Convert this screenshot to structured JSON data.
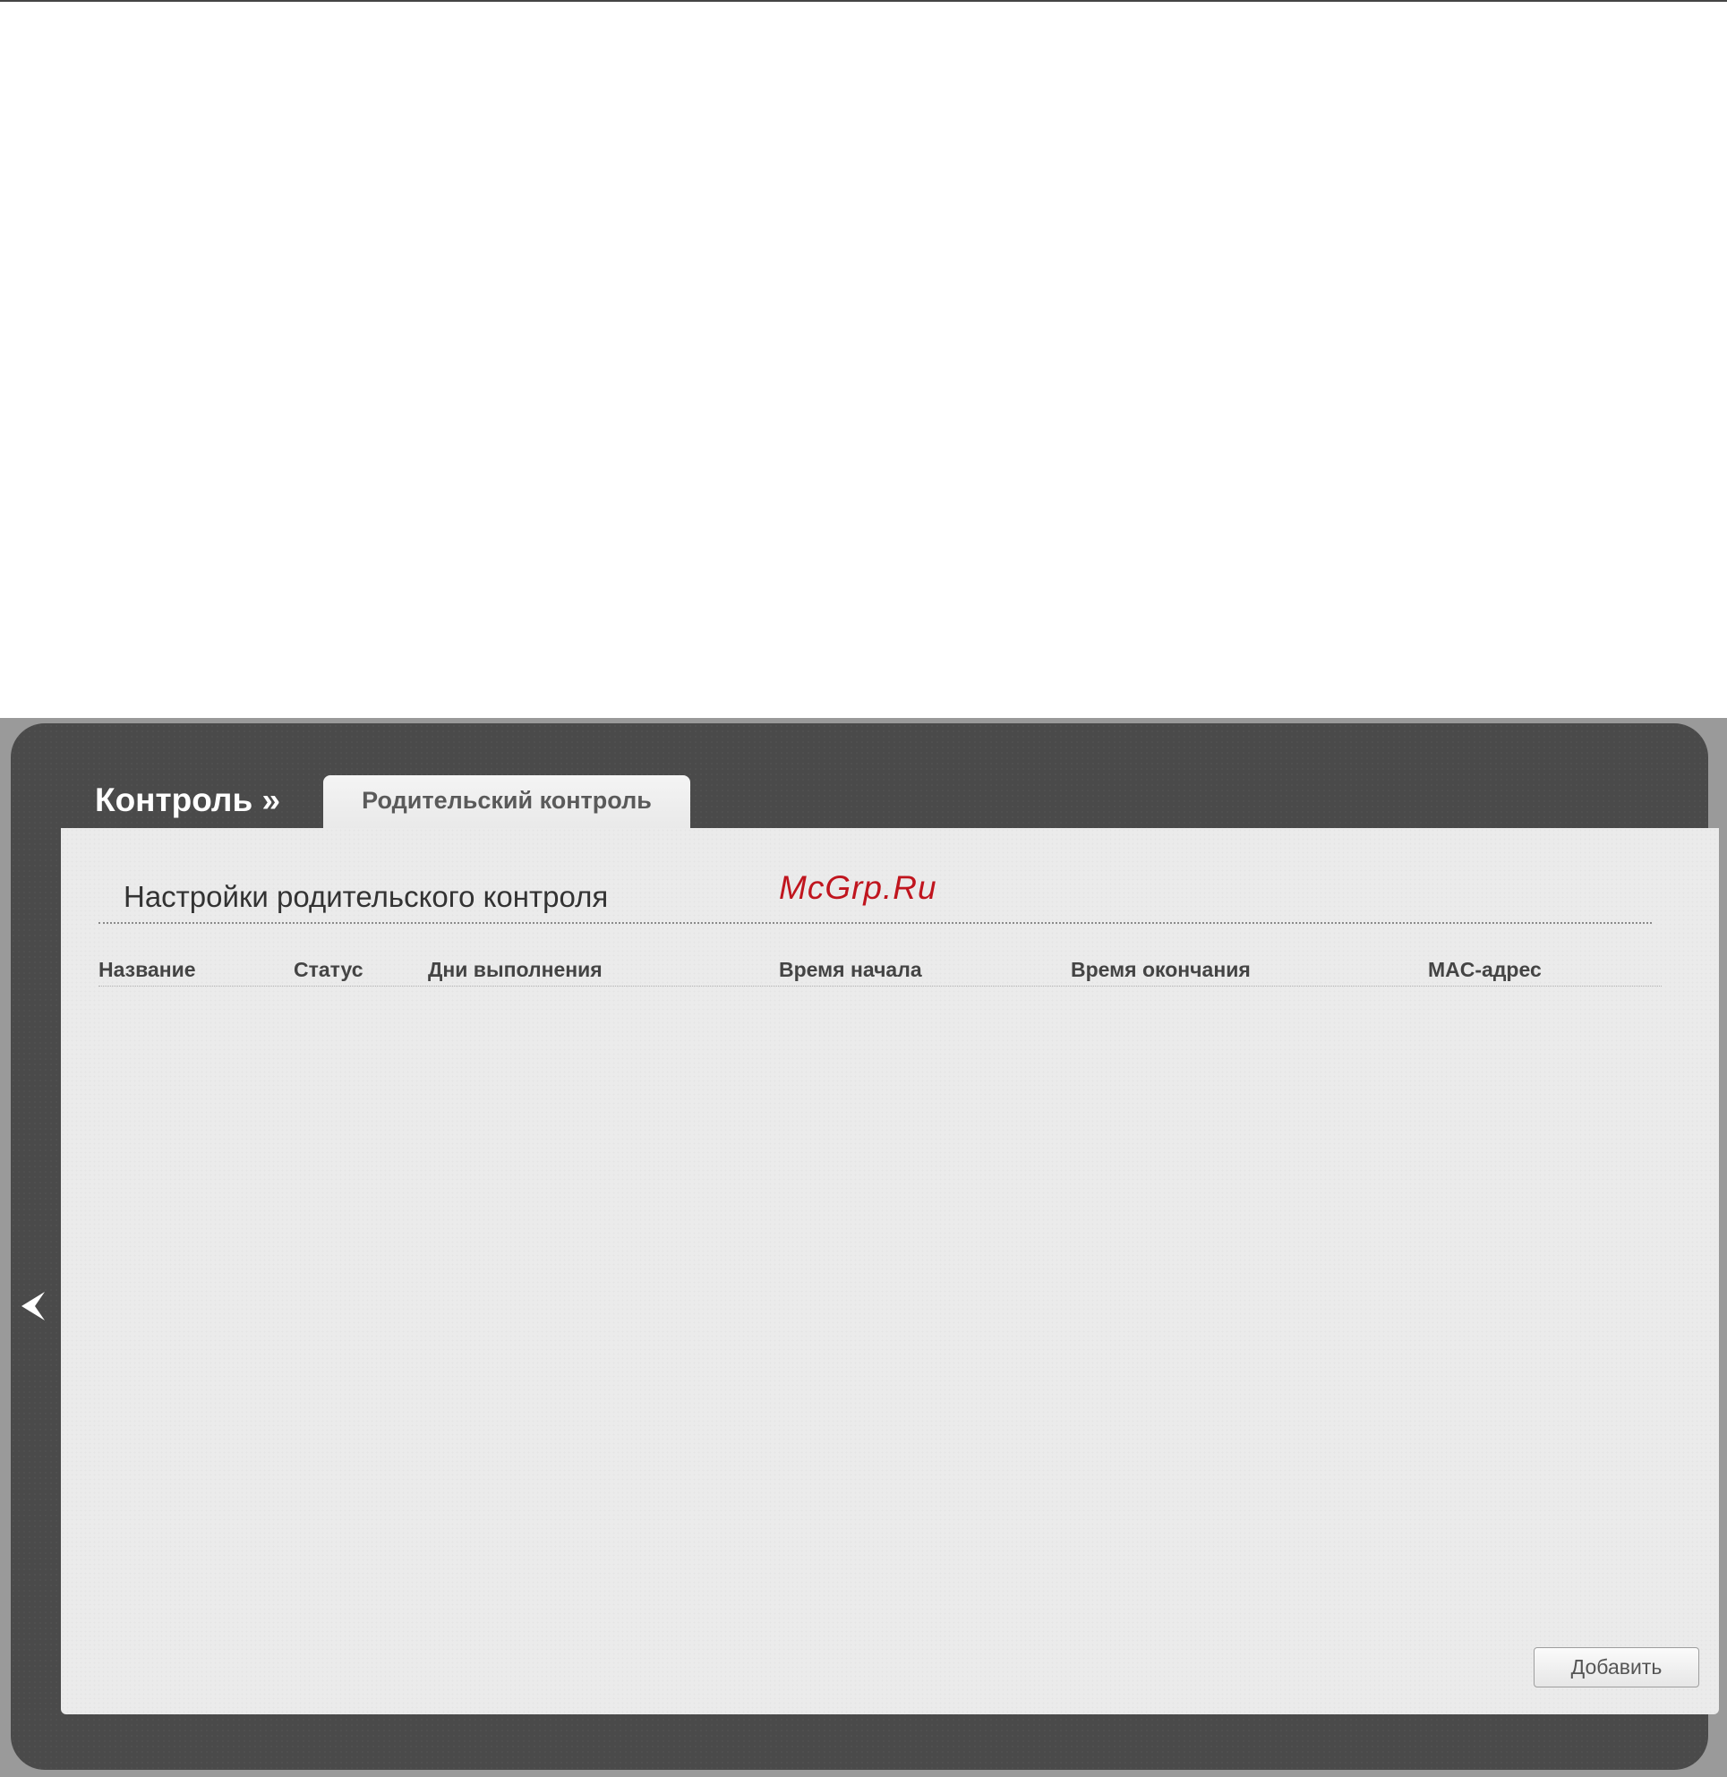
{
  "header": {
    "section_title": "Контроль »",
    "active_tab": "Родительский контроль"
  },
  "panel": {
    "title": "Настройки родительского контроля",
    "watermark": "McGrp.Ru"
  },
  "table": {
    "columns": [
      "Название",
      "Статус",
      "Дни выполнения",
      "Время начала",
      "Время окончания",
      "MAC-адрес"
    ],
    "rows": []
  },
  "actions": {
    "add_label": "Добавить"
  },
  "icons": {
    "back": "chevron-left-icon"
  },
  "colors": {
    "shell": "#4a4a4a",
    "panel": "#ebebeb",
    "watermark": "#c0151e"
  }
}
